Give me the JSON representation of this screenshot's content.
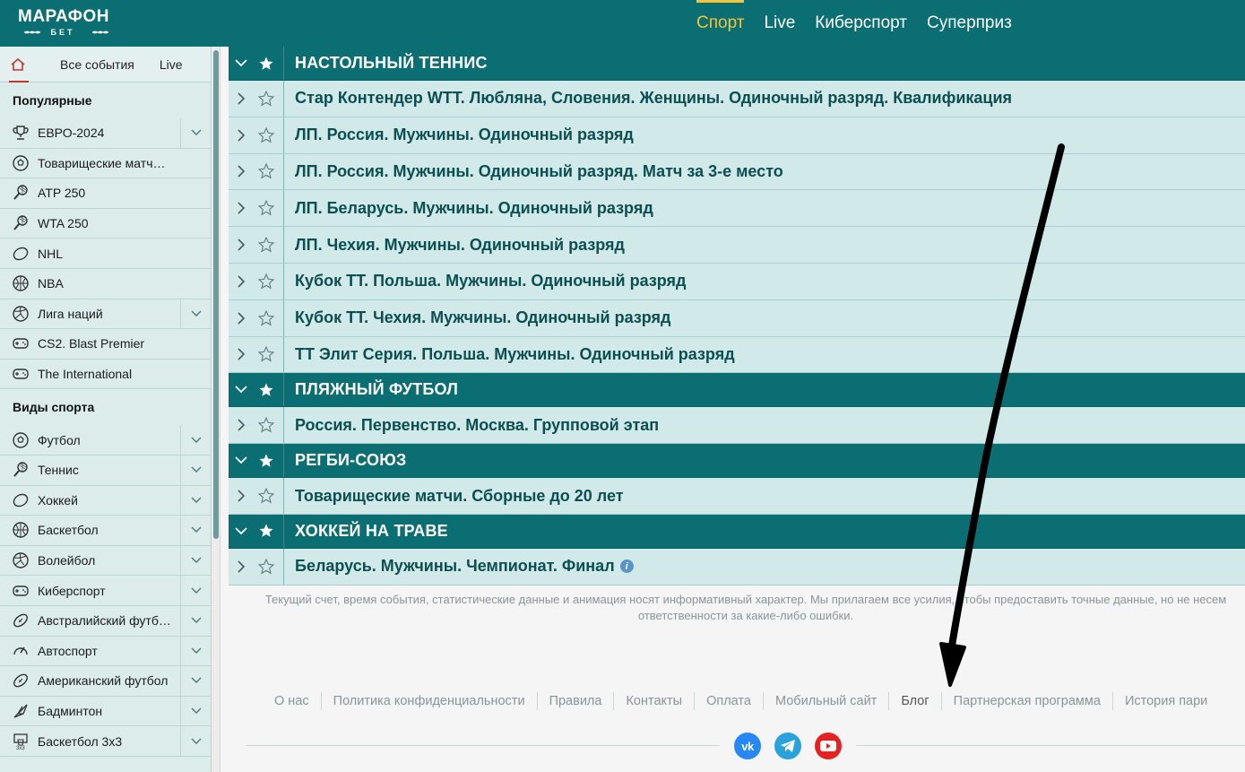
{
  "header": {
    "logo_main": "МАРАФОН",
    "logo_sub": "БЕТ",
    "nav": [
      {
        "label": "Спорт",
        "active": true
      },
      {
        "label": "Live",
        "active": false
      },
      {
        "label": "Киберспорт",
        "active": false
      },
      {
        "label": "Суперприз",
        "active": false
      }
    ]
  },
  "sidebar": {
    "tabs": {
      "all": "Все события",
      "live": "Live"
    },
    "popular_title": "Популярные",
    "popular": [
      {
        "label": "ЕВРО-2024",
        "icon": "trophy-icon",
        "expand": true
      },
      {
        "label": "Товарищеские матчи. Сбор...",
        "icon": "soccer-ball-icon",
        "expand": false
      },
      {
        "label": "ATP 250",
        "icon": "tennis-racket-icon",
        "expand": false
      },
      {
        "label": "WTA 250",
        "icon": "tennis-racket-icon",
        "expand": false
      },
      {
        "label": "NHL",
        "icon": "hockey-puck-icon",
        "expand": false
      },
      {
        "label": "NBA",
        "icon": "basketball-icon",
        "expand": false
      },
      {
        "label": "Лига наций",
        "icon": "volleyball-icon",
        "expand": true
      },
      {
        "label": "CS2. Blast Premier",
        "icon": "gamepad-icon",
        "expand": false
      },
      {
        "label": "The International",
        "icon": "gamepad-icon",
        "expand": false
      }
    ],
    "sports_title": "Виды спорта",
    "sports": [
      {
        "label": "Футбол",
        "icon": "soccer-ball-icon"
      },
      {
        "label": "Теннис",
        "icon": "tennis-racket-icon"
      },
      {
        "label": "Хоккей",
        "icon": "hockey-puck-icon"
      },
      {
        "label": "Баскетбол",
        "icon": "basketball-icon"
      },
      {
        "label": "Волейбол",
        "icon": "volleyball-icon"
      },
      {
        "label": "Киберспорт",
        "icon": "gamepad-icon"
      },
      {
        "label": "Австралийский футбол",
        "icon": "rugby-ball-icon"
      },
      {
        "label": "Автоспорт",
        "icon": "speedometer-icon"
      },
      {
        "label": "Американский футбол",
        "icon": "rugby-ball-icon"
      },
      {
        "label": "Бадминтон",
        "icon": "shuttlecock-icon"
      },
      {
        "label": "Баскетбол 3х3",
        "icon": "basketball-hoop-icon"
      }
    ]
  },
  "main": {
    "groups": [
      {
        "title": "НАСТОЛЬНЫЙ ТЕННИС",
        "events": [
          "Стар Контендер WTT. Любляна, Словения. Женщины. Одиночный разряд. Квалификация",
          "ЛП. Россия. Мужчины. Одиночный разряд",
          "ЛП. Россия. Мужчины. Одиночный разряд. Матч за 3-е место",
          "ЛП. Беларусь. Мужчины. Одиночный разряд",
          "ЛП. Чехия. Мужчины. Одиночный разряд",
          "Кубок ТТ. Польша. Мужчины. Одиночный разряд",
          "Кубок ТТ. Чехия. Мужчины. Одиночный разряд",
          "ТТ Элит Серия. Польша. Мужчины. Одиночный разряд"
        ]
      },
      {
        "title": "ПЛЯЖНЫЙ ФУТБОЛ",
        "events": [
          "Россия. Первенство. Москва. Групповой этап"
        ]
      },
      {
        "title": "РЕГБИ-СОЮЗ",
        "events": [
          "Товарищеские матчи. Сборные до 20 лет"
        ]
      },
      {
        "title": "ХОККЕЙ НА ТРАВЕ",
        "events": [
          "Беларусь. Мужчины. Чемпионат. Финал"
        ]
      }
    ],
    "info_glyph": "i"
  },
  "disclaimer": {
    "line1": "Текущий счет, время события, статистические данные и анимация носят информативный характер. Мы прилагаем все усилия, чтобы предоставить точные данные, но не несем",
    "line2": "ответственности за какие-либо ошибки."
  },
  "footer": {
    "links": [
      "О нас",
      "Политика конфиденциальности",
      "Правила",
      "Контакты",
      "Оплата",
      "Мобильный сайт",
      "Блог",
      "Партнерская программа",
      "История пари"
    ],
    "social": [
      {
        "name": "vk",
        "label": "vk",
        "color": "#2787f5"
      },
      {
        "name": "telegram",
        "label": "",
        "color": "#2aa3dc"
      },
      {
        "name": "youtube",
        "label": "",
        "color": "#e52222"
      }
    ]
  },
  "colors": {
    "brand": "#0a6e72",
    "accent": "#f4c53b",
    "row": "#d1e9e8"
  }
}
